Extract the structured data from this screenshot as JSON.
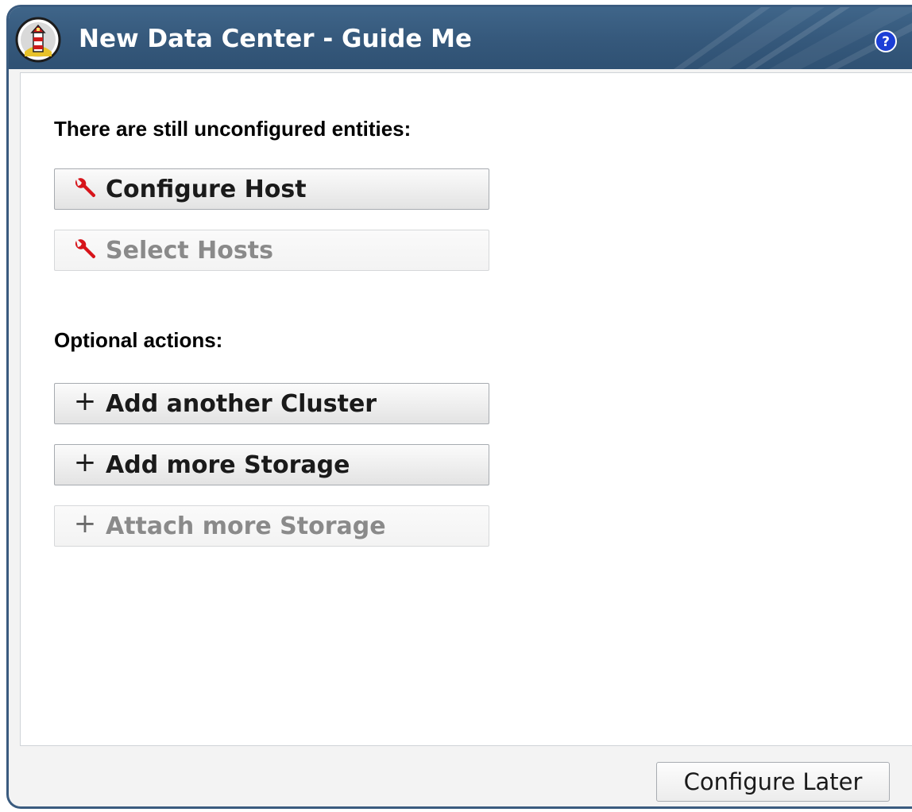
{
  "dialog": {
    "title": "New Data Center - Guide Me",
    "app_icon": "lighthouse-logo-icon",
    "help_icon": "help-question-icon"
  },
  "unconfigured": {
    "heading": "There are still unconfigured entities:",
    "actions": [
      {
        "label": "Configure Host",
        "icon": "wrench-icon",
        "enabled": true
      },
      {
        "label": "Select Hosts",
        "icon": "wrench-icon",
        "enabled": false
      }
    ]
  },
  "optional": {
    "heading": "Optional actions:",
    "actions": [
      {
        "label": "Add another Cluster",
        "icon": "plus-icon",
        "enabled": true
      },
      {
        "label": "Add more Storage",
        "icon": "plus-icon",
        "enabled": true
      },
      {
        "label": "Attach more Storage",
        "icon": "plus-icon",
        "enabled": false
      }
    ]
  },
  "footer": {
    "configure_later_label": "Configure Later"
  },
  "colors": {
    "titlebar": "#35587b",
    "wrench": "#d7141a",
    "border": "#3a5b7f"
  }
}
